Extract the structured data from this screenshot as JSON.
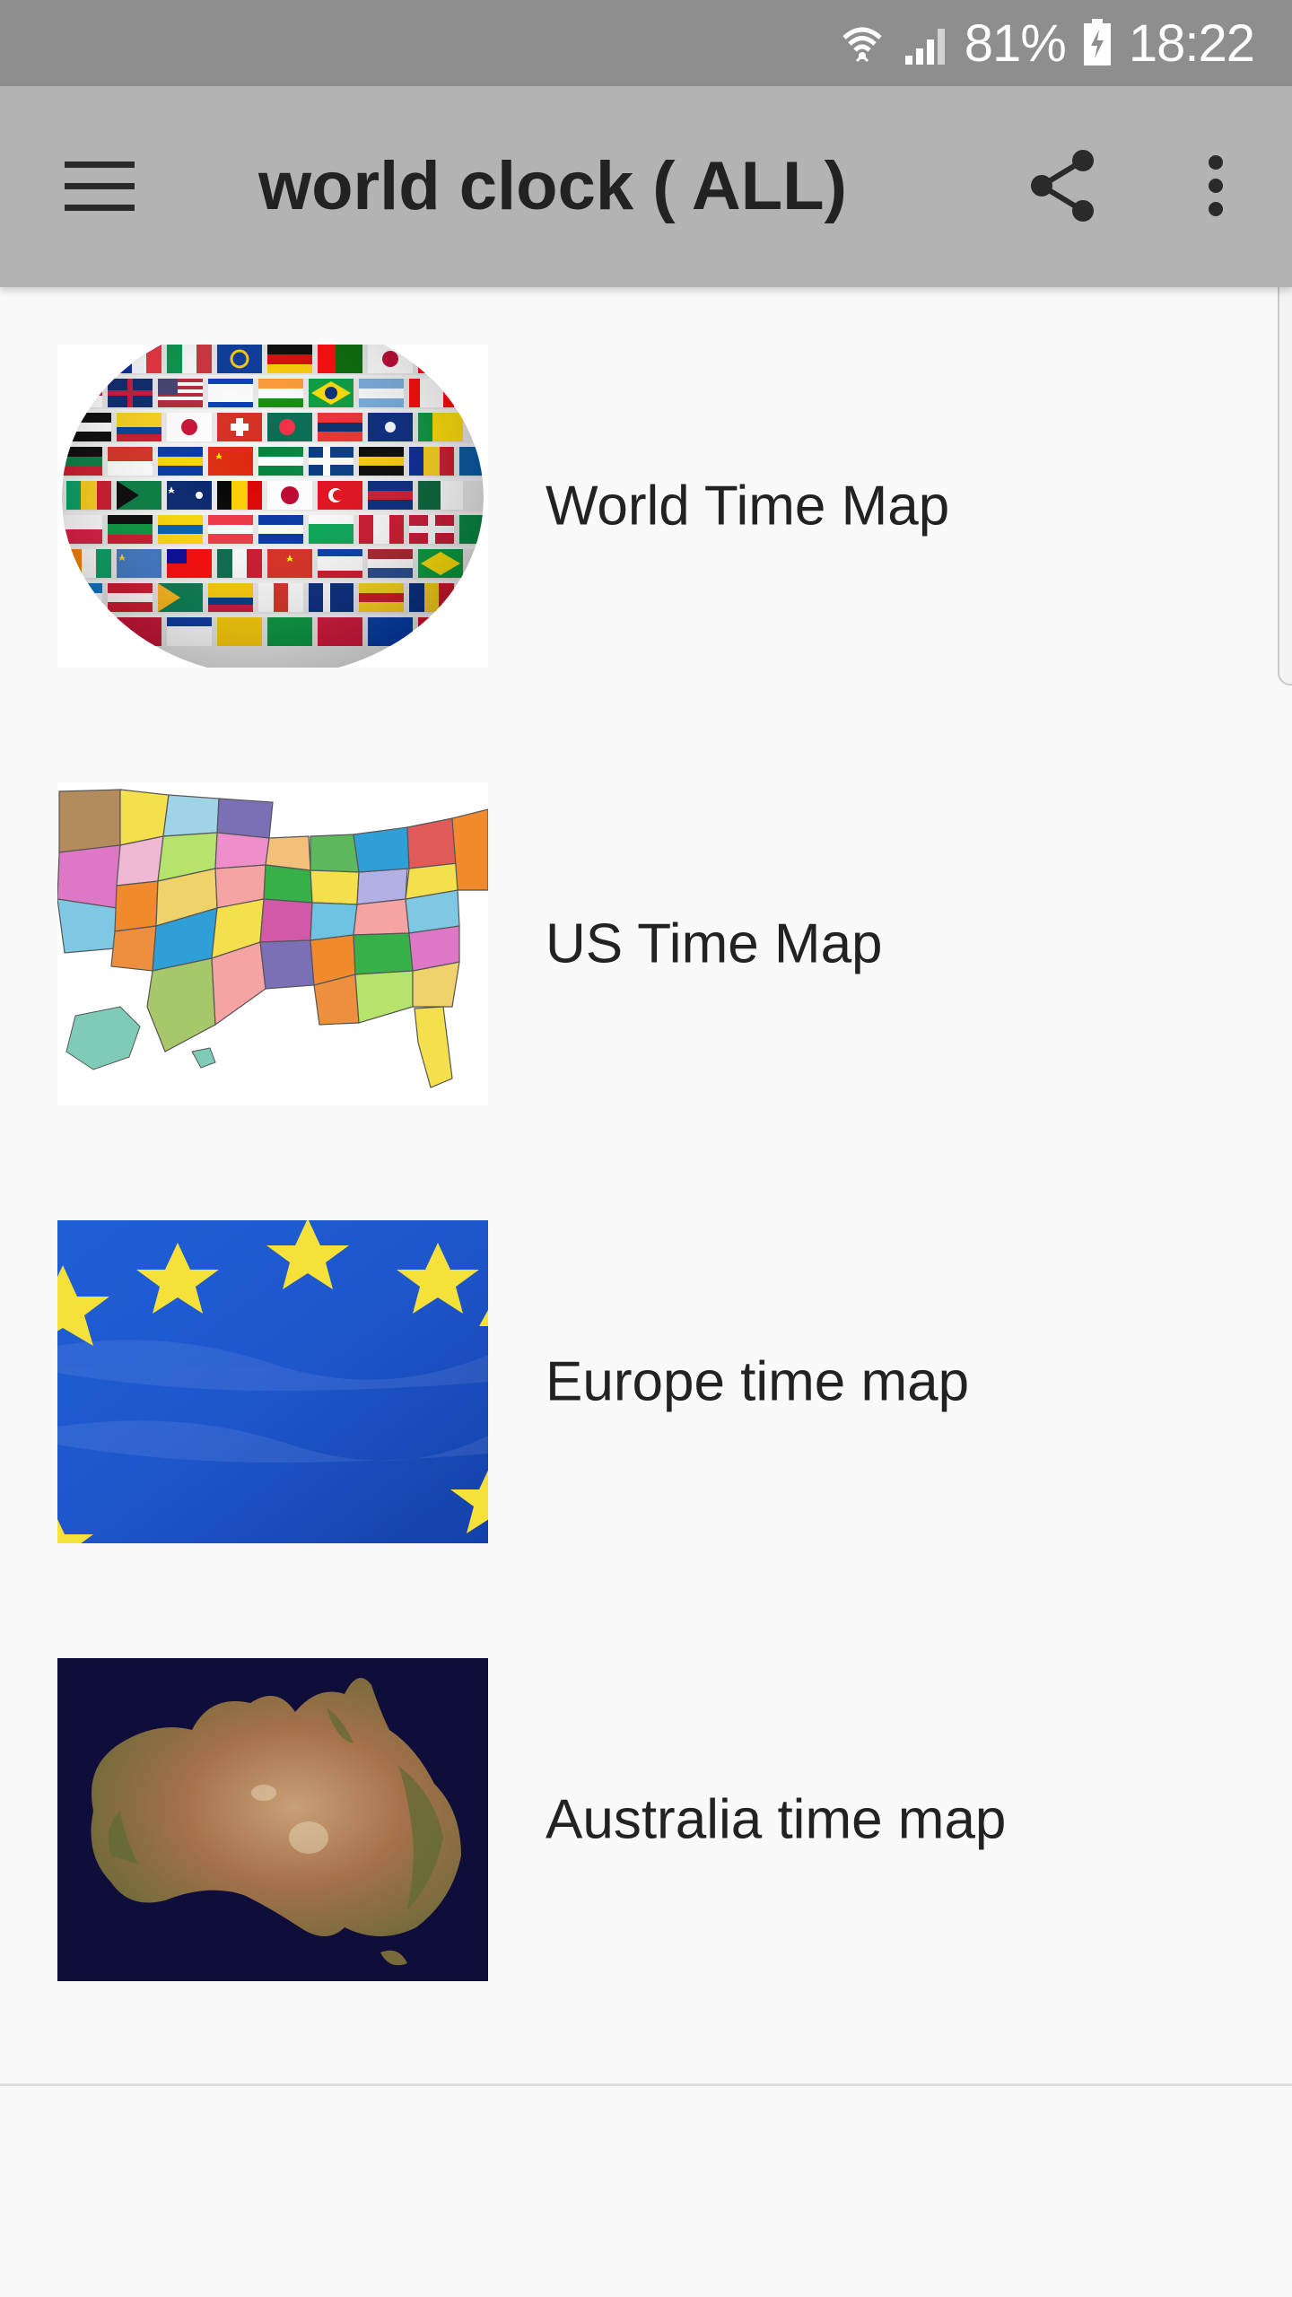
{
  "status_bar": {
    "battery": "81%",
    "time": "18:22",
    "icons": [
      "wifi-icon",
      "signal-icon",
      "battery-icon"
    ]
  },
  "toolbar": {
    "title": "world clock ( ALL)",
    "menu_icon": "menu-icon",
    "share_icon": "share-icon",
    "more_icon": "more-vert-icon"
  },
  "list": {
    "items": [
      {
        "label": "World Time Map",
        "image": "flag-globe-image"
      },
      {
        "label": "US Time Map",
        "image": "us-states-map-image"
      },
      {
        "label": "Europe time map",
        "image": "eu-flag-image"
      },
      {
        "label": "Australia time map",
        "image": "australia-satellite-image"
      }
    ]
  },
  "colors": {
    "status_bar": "#8e8e8e",
    "toolbar": "#b3b3b3",
    "background": "#f9f9f9",
    "text": "#222222"
  }
}
